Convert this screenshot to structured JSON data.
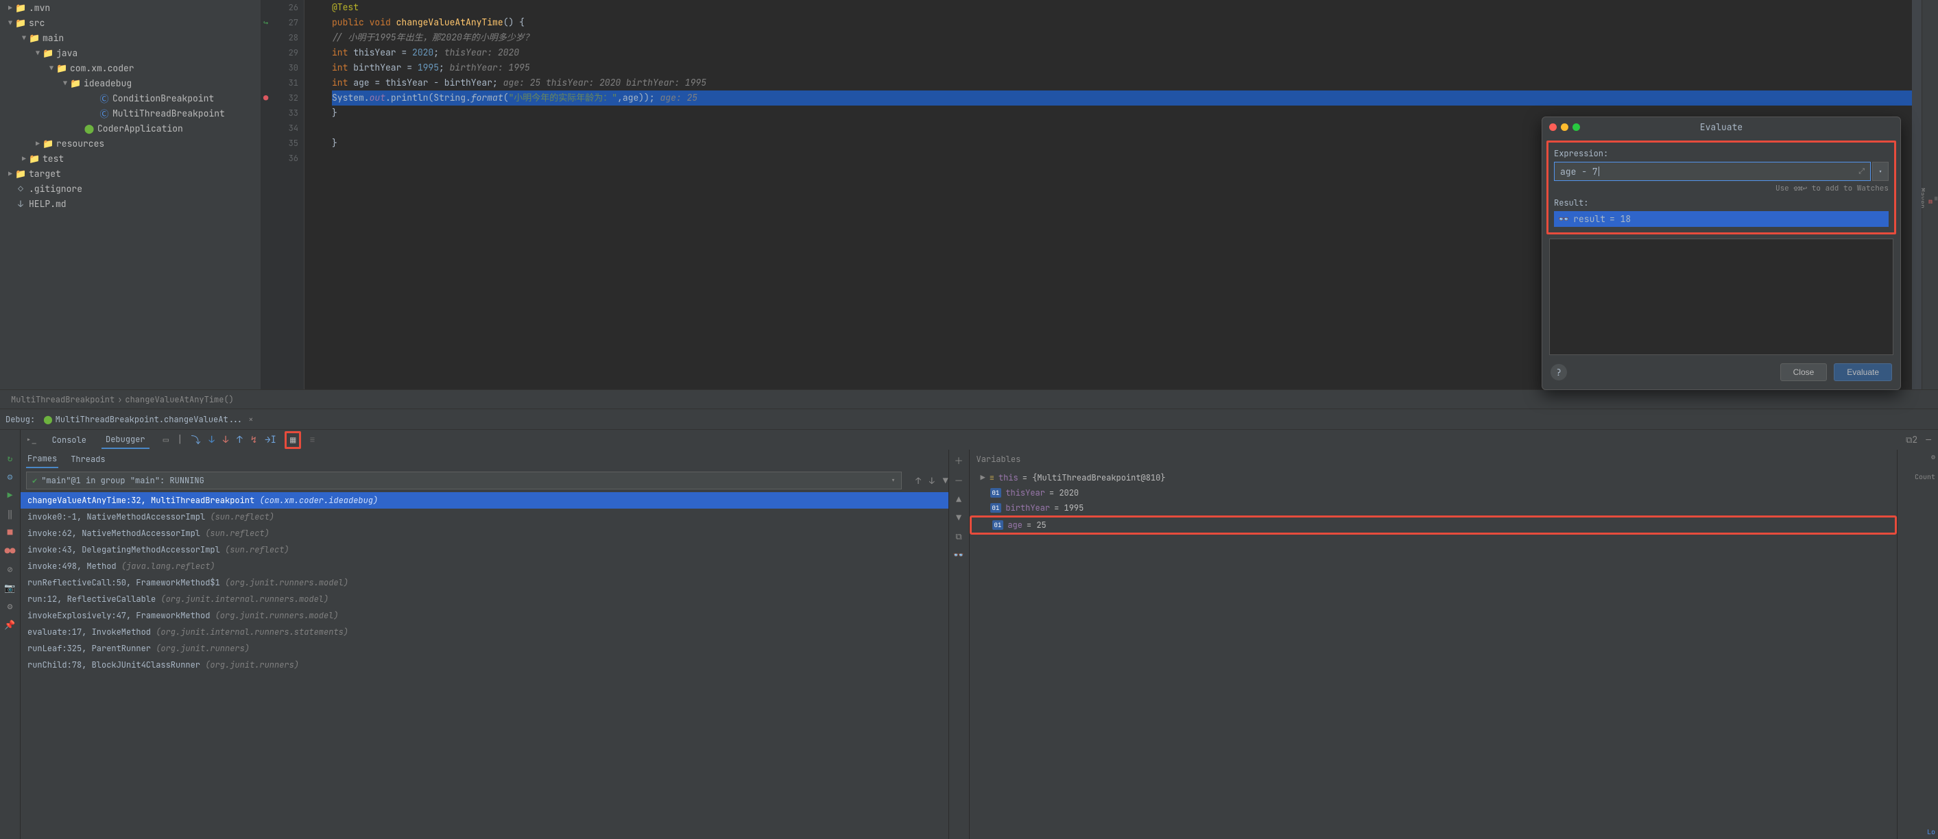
{
  "tree": {
    "items": [
      {
        "lvl": "lvl1",
        "arrow": "▶",
        "icon": "📁",
        "name": ".mvn",
        "iconClass": "folder-icon"
      },
      {
        "lvl": "lvl1",
        "arrow": "▼",
        "icon": "📁",
        "name": "src",
        "iconClass": "folder-icon"
      },
      {
        "lvl": "lvl2",
        "arrow": "▼",
        "icon": "📁",
        "name": "main",
        "iconClass": "folder-icon"
      },
      {
        "lvl": "lvl3",
        "arrow": "▼",
        "icon": "📁",
        "name": "java",
        "iconClass": "folder-icon"
      },
      {
        "lvl": "lvl4",
        "arrow": "▼",
        "icon": "📁",
        "name": "com.xm.coder",
        "iconClass": "folder-icon"
      },
      {
        "lvl": "lvl5",
        "arrow": "▼",
        "icon": "📁",
        "name": "ideadebug",
        "iconClass": "folder-icon"
      },
      {
        "lvl": "lvl6",
        "arrow": "",
        "icon": "Ⓒ",
        "name": "ConditionBreakpoint",
        "iconClass": "class-icon"
      },
      {
        "lvl": "lvl6",
        "arrow": "",
        "icon": "Ⓒ",
        "name": "MultiThreadBreakpoint",
        "iconClass": "class-icon"
      },
      {
        "lvl": "lvl6b",
        "arrow": "",
        "icon": "⬤",
        "name": "CoderApplication",
        "iconClass": "spring-icon"
      },
      {
        "lvl": "lvl3",
        "arrow": "▶",
        "icon": "📁",
        "name": "resources",
        "iconClass": "folder-icon"
      },
      {
        "lvl": "lvl2",
        "arrow": "▶",
        "icon": "📁",
        "name": "test",
        "iconClass": "folder-icon"
      },
      {
        "lvl": "lvl1",
        "arrow": "▶",
        "icon": "📁",
        "name": "target",
        "iconClass": "target-icon"
      },
      {
        "lvl": "lvl1",
        "arrow": "",
        "icon": "◇",
        "name": ".gitignore",
        "iconClass": "folder-icon"
      },
      {
        "lvl": "lvl1",
        "arrow": "",
        "icon": "↓",
        "name": "HELP.md",
        "iconClass": "folder-icon"
      }
    ]
  },
  "editor": {
    "lines": [
      {
        "n": 26,
        "html": "<span class='ann'>@Test</span>"
      },
      {
        "n": 27,
        "impl": true,
        "html": "<span class='kw'>public void</span> <span class='method'>changeValueAtAnyTime</span>() {"
      },
      {
        "n": 28,
        "html": "    <span class='com'>// 小明于1995年出生，那2020年的小明多少岁？</span>"
      },
      {
        "n": 29,
        "html": "    <span class='kw'>int</span> thisYear = <span class='num'>2020</span>;  <span class='com'>thisYear: 2020</span>"
      },
      {
        "n": 30,
        "html": "    <span class='kw'>int</span> birthYear = <span class='num'>1995</span>;  <span class='com'>birthYear: 1995</span>"
      },
      {
        "n": 31,
        "html": "    <span class='kw'>int</span> age = thisYear - birthYear;  <span class='com'>age: 25   thisYear: 2020   birthYear: 1995</span>"
      },
      {
        "n": 32,
        "bp": true,
        "hl": true,
        "html": "    System.<span class='field'>out</span>.println(String.<span style='font-style:italic'>format</span>(<span class='str'>\"小明今年的实际年龄为：\"</span>,age));  <span class='com'>age: 25</span>"
      },
      {
        "n": 33,
        "html": "}"
      },
      {
        "n": 34,
        "html": ""
      },
      {
        "n": 35,
        "html": "}"
      },
      {
        "n": 36,
        "html": ""
      }
    ]
  },
  "breadcrumbs": {
    "a": "MultiThreadBreakpoint",
    "sep": "›",
    "b": "changeValueAtAnyTime()"
  },
  "debug": {
    "label": "Debug:",
    "config": "MultiThreadBreakpoint.changeValueAt...",
    "tabs": {
      "console": "Console",
      "debugger": "Debugger"
    },
    "frames_tab": "Frames",
    "threads_tab": "Threads",
    "thread": "\"main\"@1 in group \"main\": RUNNING",
    "frames": [
      {
        "m": "changeValueAtAnyTime:32, MultiThreadBreakpoint ",
        "p": "(com.xm.coder.ideadebug)",
        "sel": true
      },
      {
        "m": "invoke0:-1, NativeMethodAccessorImpl ",
        "p": "(sun.reflect)"
      },
      {
        "m": "invoke:62, NativeMethodAccessorImpl ",
        "p": "(sun.reflect)"
      },
      {
        "m": "invoke:43, DelegatingMethodAccessorImpl ",
        "p": "(sun.reflect)"
      },
      {
        "m": "invoke:498, Method ",
        "p": "(java.lang.reflect)"
      },
      {
        "m": "runReflectiveCall:50, FrameworkMethod$1 ",
        "p": "(org.junit.runners.model)"
      },
      {
        "m": "run:12, ReflectiveCallable ",
        "p": "(org.junit.internal.runners.model)"
      },
      {
        "m": "invokeExplosively:47, FrameworkMethod ",
        "p": "(org.junit.runners.model)"
      },
      {
        "m": "evaluate:17, InvokeMethod ",
        "p": "(org.junit.internal.runners.statements)"
      },
      {
        "m": "runLeaf:325, ParentRunner ",
        "p": "(org.junit.runners)"
      },
      {
        "m": "runChild:78, BlockJUnit4ClassRunner ",
        "p": "(org.junit.runners)"
      }
    ]
  },
  "variables": {
    "title": "Variables",
    "rows": [
      {
        "badge": "",
        "name": "this",
        "val": "= {MultiThreadBreakpoint@810}",
        "arrow": true
      },
      {
        "badge": "01",
        "name": "thisYear",
        "val": "= 2020"
      },
      {
        "badge": "01",
        "name": "birthYear",
        "val": "= 1995"
      },
      {
        "badge": "01",
        "name": "age",
        "val": "= 25",
        "hl": true
      }
    ]
  },
  "evaluate": {
    "title": "Evaluate",
    "expr_label": "Expression:",
    "expr_value": "age - 7",
    "hint": "Use ⇧⌘↩ to add to Watches",
    "result_label": "Result:",
    "result_name": "result",
    "result_val": "= 18",
    "close": "Close",
    "eval": "Evaluate"
  },
  "rightPanel": {
    "count": "Count"
  },
  "sidetabs": {
    "maven": "Maven"
  },
  "bottomRight": {
    "link": "Lo"
  }
}
